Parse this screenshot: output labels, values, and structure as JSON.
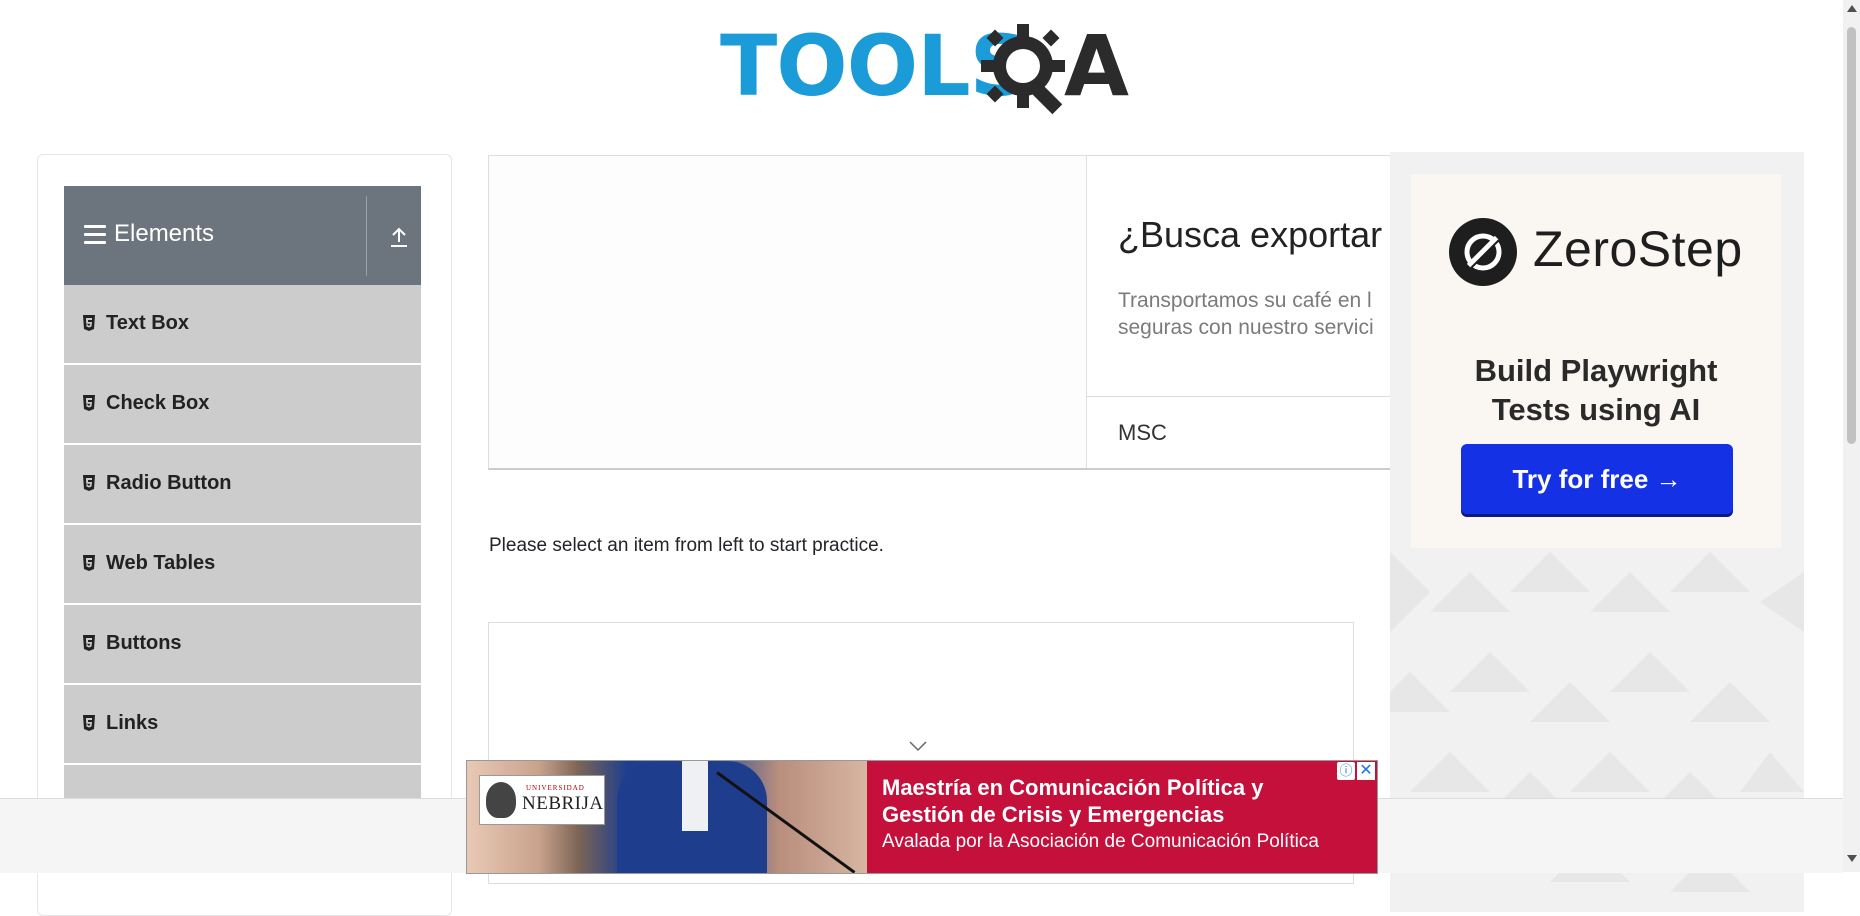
{
  "logo": {
    "text_left": "TOOLS",
    "text_right": "A",
    "alt": "TOOLSQA"
  },
  "sidebar": {
    "group_title": "Elements",
    "items": [
      {
        "label": "Text Box"
      },
      {
        "label": "Check Box"
      },
      {
        "label": "Radio Button"
      },
      {
        "label": "Web Tables"
      },
      {
        "label": "Buttons"
      },
      {
        "label": "Links"
      }
    ]
  },
  "ad_card": {
    "headline": "¿Busca exportar",
    "description_line1": "Transportamos su café en l",
    "description_line2": "seguras con nuestro servici",
    "brand": "MSC"
  },
  "main": {
    "info_text": "Please select an item from left to start practice."
  },
  "zerostep_ad": {
    "brand": "ZeroStep",
    "tagline_line1": "Build Playwright",
    "tagline_line2": "Tests using AI",
    "cta": "Try for free →"
  },
  "bottom_ad": {
    "logo_small": "UNIVERSIDAD",
    "logo_name": "NEBRIJA",
    "title_line1": "Maestría en Comunicación Política y",
    "title_line2": "Gestión de Crisis y Emergencias",
    "subtitle": "Avalada por la Asociación de Comunicación Política",
    "adchoices_symbol": "ⓘ",
    "close_symbol": "✕"
  },
  "colors": {
    "logo_blue": "#1b9bd7",
    "sidebar_header": "#6c757d",
    "sidebar_item": "#cccccc",
    "cta_blue": "#1431e6",
    "bottom_ad_red": "#c4103a"
  }
}
